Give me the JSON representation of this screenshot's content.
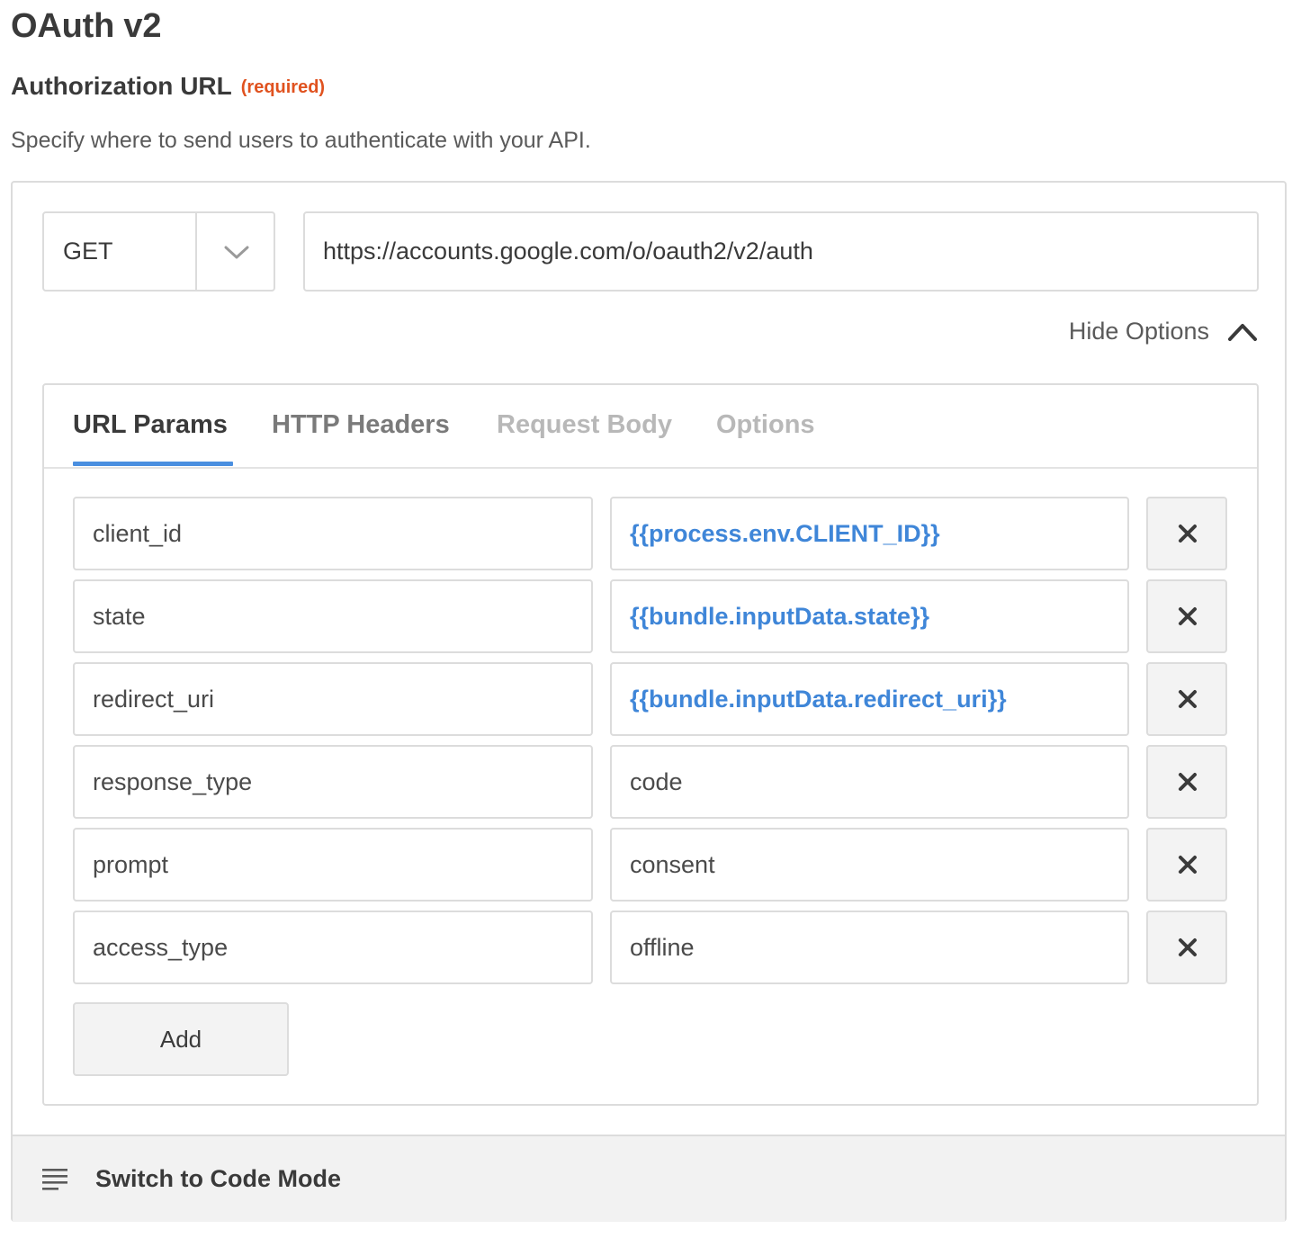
{
  "page": {
    "title": "OAuth v2"
  },
  "field": {
    "label": "Authorization URL",
    "required_text": "(required)",
    "help_text": "Specify where to send users to authenticate with your API."
  },
  "request": {
    "method": "GET",
    "url": "https://accounts.google.com/o/oauth2/v2/auth",
    "hide_options_label": "Hide Options"
  },
  "tabs": [
    {
      "label": "URL Params",
      "state": "active"
    },
    {
      "label": "HTTP Headers",
      "state": "normal"
    },
    {
      "label": "Request Body",
      "state": "muted"
    },
    {
      "label": "Options",
      "state": "muted"
    }
  ],
  "params": [
    {
      "key": "client_id",
      "value": "{{process.env.CLIENT_ID}}",
      "is_template": true
    },
    {
      "key": "state",
      "value": "{{bundle.inputData.state}}",
      "is_template": true
    },
    {
      "key": "redirect_uri",
      "value": "{{bundle.inputData.redirect_uri}}",
      "is_template": true
    },
    {
      "key": "response_type",
      "value": "code",
      "is_template": false
    },
    {
      "key": "prompt",
      "value": "consent",
      "is_template": false
    },
    {
      "key": "access_type",
      "value": "offline",
      "is_template": false
    }
  ],
  "add_button_label": "Add",
  "code_mode_label": "Switch to Code Mode",
  "colors": {
    "accent": "#4a8fe0",
    "template_text": "#3f86d8",
    "required": "#e0521f"
  },
  "icons": {
    "method_dropdown": "chevron-down-icon",
    "hide_options": "chevron-up-icon",
    "remove": "close-icon",
    "code_mode": "lines-icon"
  }
}
